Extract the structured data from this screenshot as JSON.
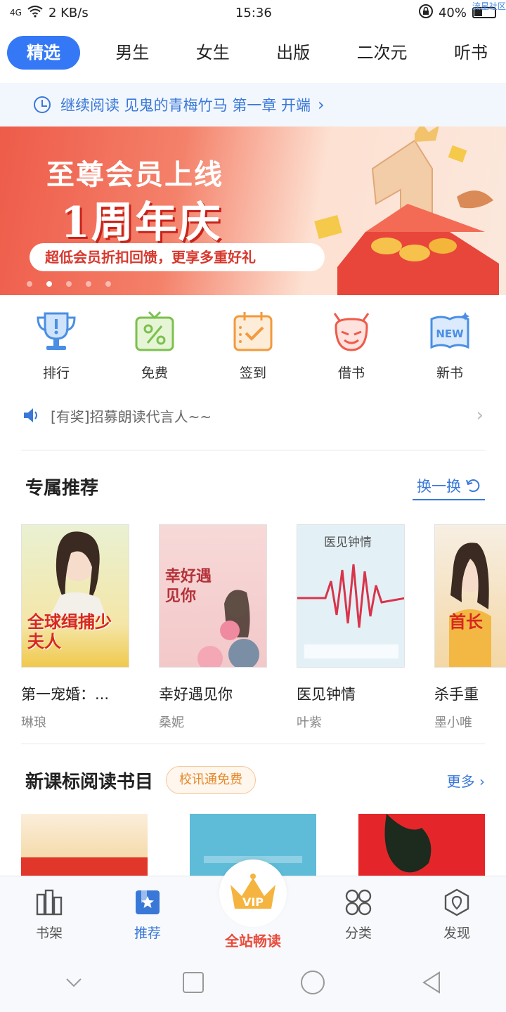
{
  "status_bar": {
    "signal": "4G",
    "speed": "2 KB/s",
    "time": "15:36",
    "battery_percent": "40%",
    "battery_level": 0.4,
    "watermark": "流星社区"
  },
  "top_tabs": [
    {
      "label": "精选",
      "active": true
    },
    {
      "label": "男生",
      "active": false
    },
    {
      "label": "女生",
      "active": false
    },
    {
      "label": "出版",
      "active": false
    },
    {
      "label": "二次元",
      "active": false
    },
    {
      "label": "听书",
      "active": false
    }
  ],
  "continue_reading": {
    "text": "继续阅读 见鬼的青梅竹马 第一章 开端"
  },
  "banner": {
    "line1": "至尊会员上线",
    "line2": "1周年庆",
    "line3": "超低会员折扣回馈，更享多重好礼",
    "dots_count": 5,
    "active_dot": 1
  },
  "quick_icons": [
    {
      "label": "排行",
      "icon": "trophy-icon"
    },
    {
      "label": "免费",
      "icon": "free-icon"
    },
    {
      "label": "签到",
      "icon": "checkin-icon"
    },
    {
      "label": "借书",
      "icon": "devil-icon"
    },
    {
      "label": "新书",
      "icon": "new-book-icon"
    }
  ],
  "notice": {
    "text": "[有奖]招募朗读代言人~~"
  },
  "exclusive": {
    "title": "专属推荐",
    "swap_label": "换一换",
    "books": [
      {
        "title": "第一宠婚：...",
        "author": "琳琅",
        "cover_text": "全球缉捕少夫人"
      },
      {
        "title": "幸好遇见你",
        "author": "桑妮",
        "cover_text": "幸好遇见你"
      },
      {
        "title": "医见钟情",
        "author": "叶紫",
        "cover_text": "医见钟情"
      },
      {
        "title": "杀手重",
        "author": "墨小唯",
        "cover_text": "首长"
      }
    ]
  },
  "curriculum": {
    "title": "新课标阅读书目",
    "badge": "校讯通免费",
    "more_label": "更多"
  },
  "bottom_nav": [
    {
      "label": "书架",
      "active": false
    },
    {
      "label": "推荐",
      "active": true
    },
    {
      "label": "全站畅读",
      "active": false,
      "vip": true
    },
    {
      "label": "分类",
      "active": false
    },
    {
      "label": "发现",
      "active": false
    }
  ],
  "vip_badge": "VIP",
  "colors": {
    "accent": "#3478f6",
    "vip_red": "#e94b3c",
    "badge_orange": "#e58a2b"
  }
}
